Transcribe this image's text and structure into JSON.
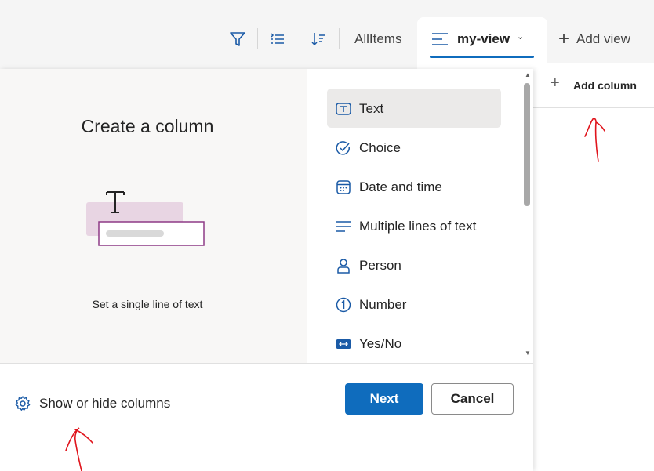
{
  "toolbar": {
    "icons": [
      "filter-icon",
      "group-by-icon",
      "sort-icon"
    ],
    "view_all_items": "AllItems",
    "current_view": "my-view",
    "add_view": "Add view"
  },
  "list": {
    "add_column": "Add column"
  },
  "panel": {
    "title": "Create a column",
    "description": "Set a single line of text",
    "column_types": [
      {
        "label": "Text",
        "icon": "text-box-icon",
        "selected": true
      },
      {
        "label": "Choice",
        "icon": "check-circle-icon"
      },
      {
        "label": "Date and time",
        "icon": "calendar-icon"
      },
      {
        "label": "Multiple lines of text",
        "icon": "multiline-text-icon"
      },
      {
        "label": "Person",
        "icon": "person-icon"
      },
      {
        "label": "Number",
        "icon": "number-circle-icon"
      },
      {
        "label": "Yes/No",
        "icon": "yes-no-toggle-icon"
      }
    ],
    "show_hide_columns": "Show or hide columns",
    "next_button": "Next",
    "cancel_button": "Cancel"
  },
  "colors": {
    "accent": "#0f6cbd",
    "icon_blue": "#1a5aa6",
    "annotation_red": "#e0141c",
    "illustration_pink": "#e8d5e3",
    "illustration_border": "#8e3a86"
  }
}
